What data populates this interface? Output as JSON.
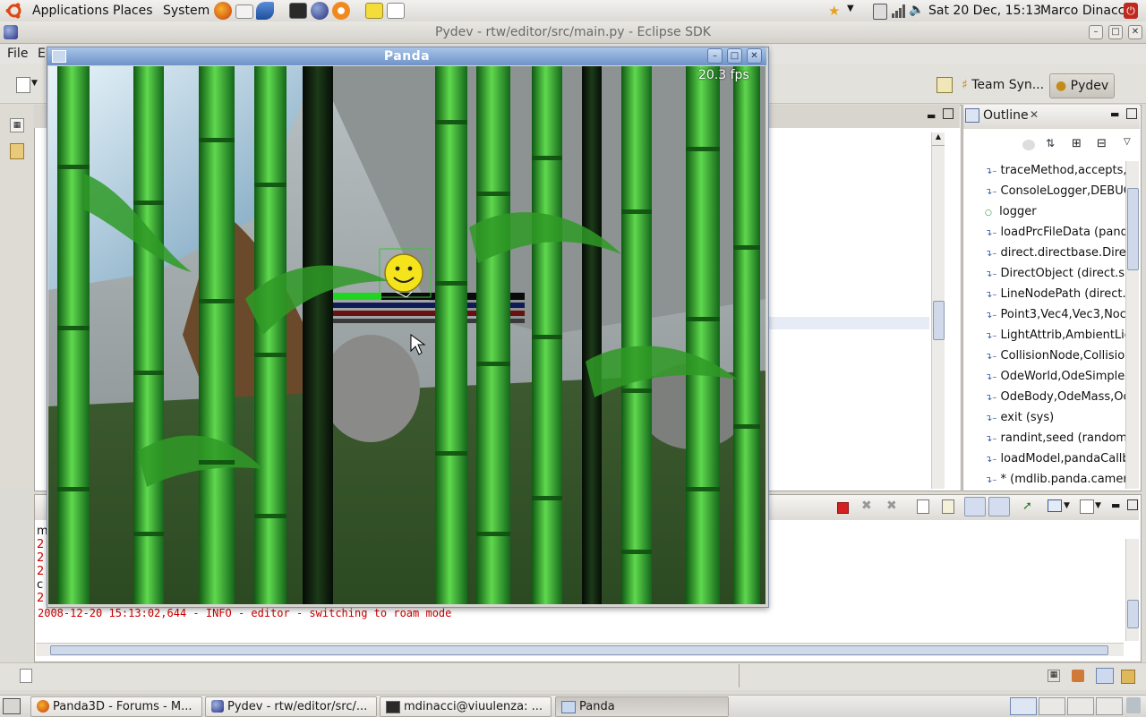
{
  "top_panel": {
    "menus": [
      "Applications",
      "Places",
      "System"
    ],
    "clock": "Sat 20 Dec, 15:13",
    "user": "Marco Dinacci"
  },
  "eclipse": {
    "title": "Pydev - rtw/editor/src/main.py - Eclipse SDK",
    "menu": [
      "File",
      "E"
    ],
    "perspectives": [
      "Team Syn...",
      "Pydev"
    ],
    "outline": {
      "tab": "Outline",
      "items": [
        "traceMethod,accepts,",
        "ConsoleLogger,DEBUG",
        "logger",
        "loadPrcFileData (pand",
        "direct.directbase.Dire",
        "DirectObject (direct.sh",
        "LineNodePath (direct.",
        "Point3,Vec4,Vec3,Noc",
        "LightAttrib,AmbientLig",
        "CollisionNode,Collisior",
        "OdeWorld,OdeSimpleS",
        "OdeBody,OdeMass,Oc",
        "exit (sys)",
        "randint,seed (random",
        "loadModel,pandaCallb",
        "* (mdlib.panda.camer"
      ]
    },
    "console": {
      "partial_prefixes": [
        "m",
        "2",
        "2",
        "2",
        "c",
        "2"
      ],
      "last_line": "2008-12-20 15:13:02,644 - INFO - editor - switching to roam mode"
    }
  },
  "panda": {
    "title": "Panda",
    "fps": "20.3 fps"
  },
  "taskbar": {
    "tasks": [
      "Panda3D - Forums - M...",
      "Pydev - rtw/editor/src/...",
      "mdinacci@viuulenza: ...",
      "Panda"
    ]
  },
  "colors": {
    "panda_titlebar": "#7fa0d0",
    "console_text": "#cc0000",
    "bamboo": "#2f9a26"
  }
}
